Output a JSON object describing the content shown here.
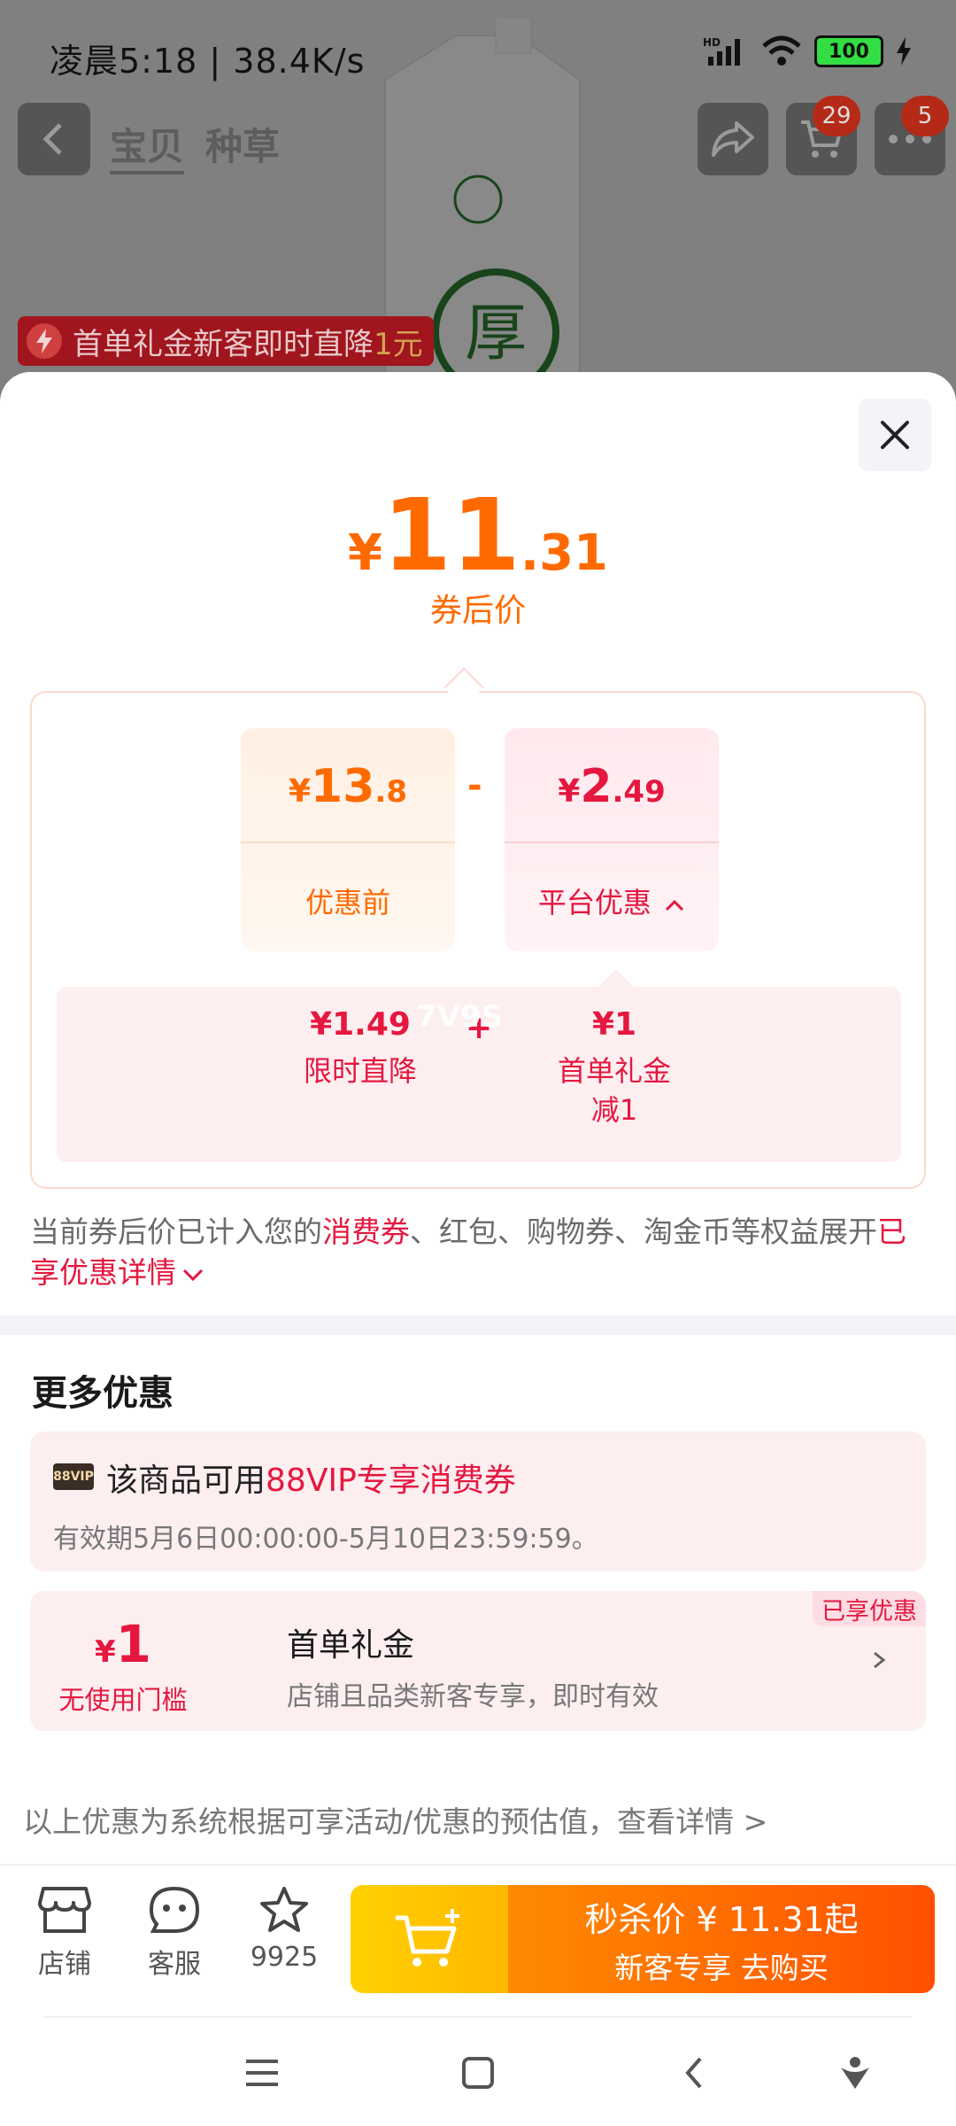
{
  "status_bar": {
    "time": "凌晨5:18 | 38.4K/s",
    "network_label": "HD",
    "battery": "100"
  },
  "top_nav": {
    "tabs": [
      "宝贝",
      "种草"
    ],
    "cart_badge": "29",
    "more_badge": "5"
  },
  "promo_banner": {
    "text": "首单礼金新客即时直降",
    "highlight": "1元"
  },
  "final_price": {
    "currency": "¥",
    "integer": "11",
    "decimal": ".31",
    "label": "券后价"
  },
  "breakdown": {
    "original": {
      "currency": "¥",
      "integer": "13",
      "decimal": ".8",
      "label": "优惠前"
    },
    "operator": "-",
    "platform": {
      "currency": "¥",
      "integer": "2",
      "decimal": ".49",
      "label": "平台优惠"
    },
    "details": [
      {
        "value": "¥1.49",
        "label": "限时直降"
      },
      {
        "value": "¥1",
        "label": "首单礼金",
        "label2": "减1"
      }
    ],
    "plus": "+"
  },
  "note": {
    "part1": "当前券后价已计入您的",
    "red1": "消费券",
    "part2": "、红包、购物券、淘金币等权益展开",
    "red2": "已享优惠详情"
  },
  "more_offers": {
    "title": "更多优惠",
    "vip": {
      "badge": "88VIP",
      "title_prefix": "该商品可用",
      "title_highlight": "88VIP专享消费券",
      "validity": "有效期5月6日00:00:00-5月10日23:59:59。"
    },
    "coupon": {
      "currency": "¥",
      "amount": "1",
      "condition": "无使用门槛",
      "title": "首单礼金",
      "subtitle": "店铺且品类新客专享，即时有效",
      "tag": "已享优惠"
    }
  },
  "footer_note": "以上优惠为系统根据可享活动/优惠的预估值，查看详情 >",
  "bottom_bar": {
    "shop": "店铺",
    "service": "客服",
    "favorites": "9925",
    "buy_line1": "秒杀价 ¥ 11.31起",
    "buy_line2": "新客专享  去购买"
  },
  "watermark": "7V9S",
  "colors": {
    "accent_orange": "#ff6a00",
    "accent_red": "#e5173f",
    "buy_gradient_start": "#ff8a00",
    "buy_gradient_end": "#ff5000",
    "cart_yellow": "#ffc800"
  }
}
